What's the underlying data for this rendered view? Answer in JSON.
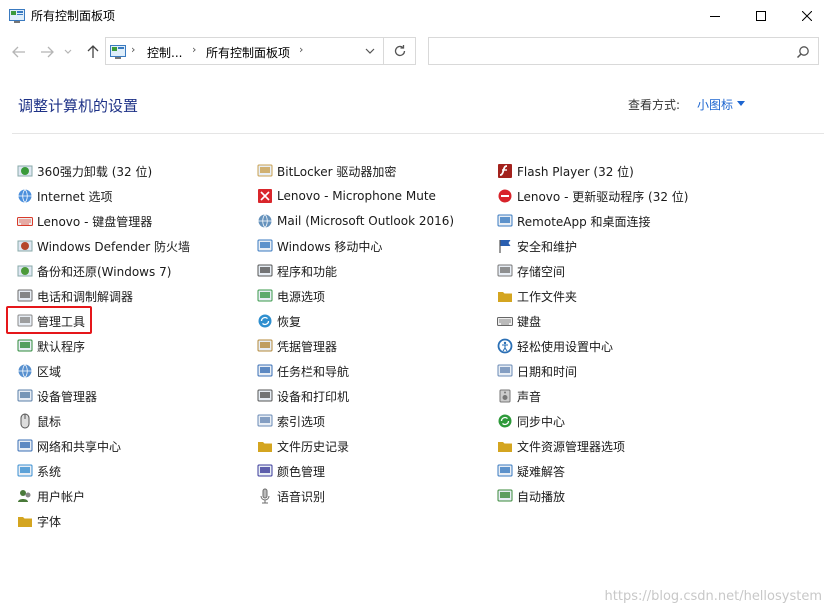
{
  "window": {
    "title": "所有控制面板项"
  },
  "address": {
    "crumbs": [
      "控制...",
      "所有控制面板项"
    ]
  },
  "search": {
    "placeholder": ""
  },
  "header": {
    "heading": "调整计算机的设置",
    "view_by_label": "查看方式:",
    "view_by_value": "小图标"
  },
  "columns": [
    {
      "items": [
        {
          "label": "360强力卸载 (32 位)",
          "icon": "uninstall-icon",
          "color": "#3a9a3a"
        },
        {
          "label": "Internet 选项",
          "icon": "internet-globe-icon",
          "color": "#2b7bd6"
        },
        {
          "label": "Lenovo - 键盘管理器",
          "icon": "lenovo-keyboard-icon",
          "color": "#d83b2b"
        },
        {
          "label": "Windows Defender 防火墙",
          "icon": "firewall-icon",
          "color": "#b5462a"
        },
        {
          "label": "备份和还原(Windows 7)",
          "icon": "backup-icon",
          "color": "#4c9a3a"
        },
        {
          "label": "电话和调制解调器",
          "icon": "phone-modem-icon",
          "color": "#6b6b6b"
        },
        {
          "label": "管理工具",
          "icon": "admin-tools-icon",
          "color": "#8a8a8a"
        },
        {
          "label": "默认程序",
          "icon": "default-programs-icon",
          "color": "#2e8b3a"
        },
        {
          "label": "区域",
          "icon": "region-icon",
          "color": "#3a7dc7"
        },
        {
          "label": "设备管理器",
          "icon": "device-manager-icon",
          "color": "#5a7fa8"
        },
        {
          "label": "鼠标",
          "icon": "mouse-icon",
          "color": "#555555"
        },
        {
          "label": "网络和共享中心",
          "icon": "network-icon",
          "color": "#3a6fb5"
        },
        {
          "label": "系统",
          "icon": "system-icon",
          "color": "#3a8fd1"
        },
        {
          "label": "用户帐户",
          "icon": "user-accounts-icon",
          "color": "#4a7a3a"
        },
        {
          "label": "字体",
          "icon": "fonts-icon",
          "color": "#d4a520"
        }
      ]
    },
    {
      "items": [
        {
          "label": "BitLocker 驱动器加密",
          "icon": "bitlocker-icon",
          "color": "#c9a050"
        },
        {
          "label": "Lenovo - Microphone Mute",
          "icon": "mic-mute-icon",
          "color": "#d9262b"
        },
        {
          "label": "Mail (Microsoft Outlook 2016)",
          "icon": "mail-icon",
          "color": "#4a7fb0"
        },
        {
          "label": "Windows 移动中心",
          "icon": "mobility-center-icon",
          "color": "#3a7ac0"
        },
        {
          "label": "程序和功能",
          "icon": "programs-features-icon",
          "color": "#555555"
        },
        {
          "label": "电源选项",
          "icon": "power-options-icon",
          "color": "#3a9a4a"
        },
        {
          "label": "恢复",
          "icon": "recovery-icon",
          "color": "#2f8fcf"
        },
        {
          "label": "凭据管理器",
          "icon": "credential-manager-icon",
          "color": "#b58a3a"
        },
        {
          "label": "任务栏和导航",
          "icon": "taskbar-icon",
          "color": "#3a6fb5"
        },
        {
          "label": "设备和打印机",
          "icon": "devices-printers-icon",
          "color": "#555555"
        },
        {
          "label": "索引选项",
          "icon": "indexing-icon",
          "color": "#6a8ab5"
        },
        {
          "label": "文件历史记录",
          "icon": "file-history-icon",
          "color": "#d4a520"
        },
        {
          "label": "颜色管理",
          "icon": "color-management-icon",
          "color": "#3a3a9a"
        },
        {
          "label": "语音识别",
          "icon": "speech-recognition-icon",
          "color": "#6b6b6b"
        }
      ]
    },
    {
      "items": [
        {
          "label": "Flash Player (32 位)",
          "icon": "flash-player-icon",
          "color": "#a3221d"
        },
        {
          "label": "Lenovo - 更新驱动程序 (32 位)",
          "icon": "lenovo-update-icon",
          "color": "#d8232a"
        },
        {
          "label": "RemoteApp 和桌面连接",
          "icon": "remoteapp-icon",
          "color": "#3a7ac0"
        },
        {
          "label": "安全和维护",
          "icon": "security-flag-icon",
          "color": "#2a5fb0"
        },
        {
          "label": "存储空间",
          "icon": "storage-spaces-icon",
          "color": "#777777"
        },
        {
          "label": "工作文件夹",
          "icon": "work-folders-icon",
          "color": "#d4a520"
        },
        {
          "label": "键盘",
          "icon": "keyboard-icon",
          "color": "#666666"
        },
        {
          "label": "轻松使用设置中心",
          "icon": "ease-of-access-icon",
          "color": "#2a6fb5"
        },
        {
          "label": "日期和时间",
          "icon": "date-time-icon",
          "color": "#6a8ab5"
        },
        {
          "label": "声音",
          "icon": "sound-icon",
          "color": "#777777"
        },
        {
          "label": "同步中心",
          "icon": "sync-center-icon",
          "color": "#2e9a3a"
        },
        {
          "label": "文件资源管理器选项",
          "icon": "folder-options-icon",
          "color": "#d4a520"
        },
        {
          "label": "疑难解答",
          "icon": "troubleshooting-icon",
          "color": "#3a7ac0"
        },
        {
          "label": "自动播放",
          "icon": "autoplay-icon",
          "color": "#3a8a3a"
        }
      ]
    }
  ],
  "highlighted_item": "管理工具",
  "watermark": "https://blog.csdn.net/hellosystem",
  "colors": {
    "heading": "#1e3287",
    "link": "#1e66d0",
    "highlight": "#e5171a"
  }
}
